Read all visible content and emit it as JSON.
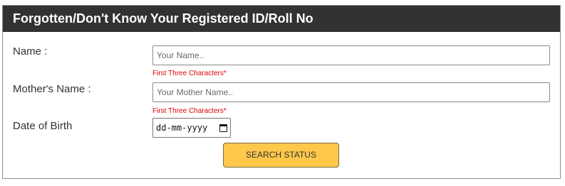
{
  "form": {
    "title": "Forgotten/Don't Know Your Registered ID/Roll No",
    "name_label": "Name :",
    "name_placeholder": "Your Name..",
    "name_hint": "First Three Characters*",
    "mother_label": "Mother's Name :",
    "mother_placeholder": "Your Mother Name..",
    "mother_hint": "First Three Characters*",
    "dob_label": "Date of Birth",
    "dob_placeholder": "dd-mm-yyyy",
    "dob_icon": "calendar-icon",
    "search_label": "SEARCH STATUS"
  },
  "colors": {
    "header_bg": "#323232",
    "hint": "#e00000",
    "button_bg": "#ffc84a"
  }
}
